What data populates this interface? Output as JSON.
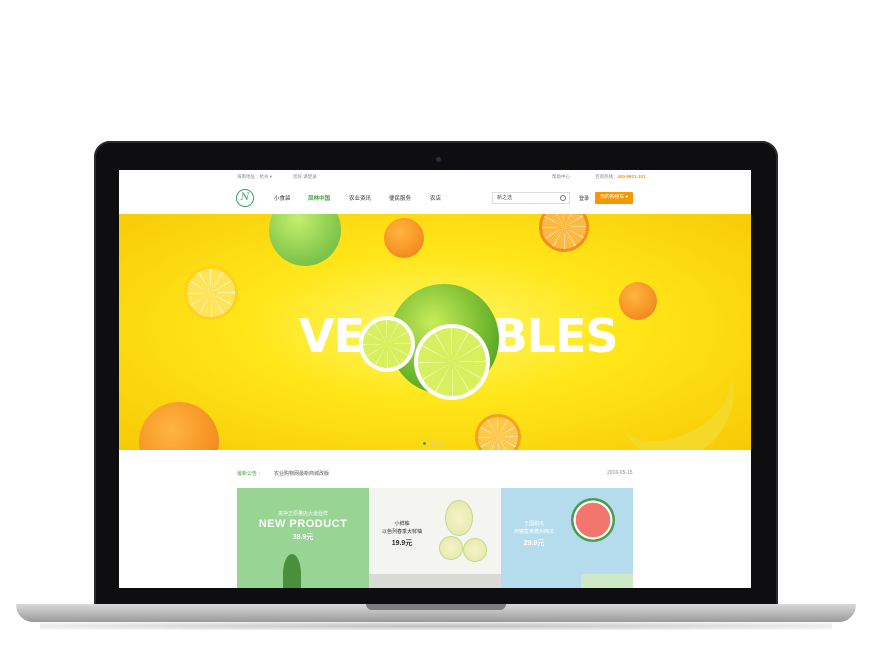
{
  "topbar": {
    "location": "海南地址：杭州 ▾",
    "login": "您好,请登录",
    "help": "帮助中心",
    "phone_label": "咨询热线：",
    "phone": "400-9921-101"
  },
  "nav": {
    "logo_letter": "N",
    "items": [
      "小食袋",
      "凤林中国",
      "农业资讯",
      "便民服务",
      "农店"
    ],
    "search_value": "新之选",
    "login_label": "登录",
    "cart_label": "我的购物车 ▾"
  },
  "banner": {
    "title": "VEGETABLES",
    "pagination_count": 3,
    "pagination_active": 0
  },
  "notice": {
    "label": "最新公告 ：",
    "text": "农业购物网最新商城改版",
    "date": "2016-05-15"
  },
  "products": [
    {
      "sub": "来净正原量店大道业样",
      "title": "NEW PRODUCT",
      "price": "38.9元"
    },
    {
      "sub1": "小鲜柚",
      "sub2": "以色列春季大鲜柚",
      "price": "19.9元"
    },
    {
      "sub1": "王国甜瓜",
      "sub2": "商镜售卖德州西瓜",
      "price": "29.9元"
    }
  ],
  "colors": {
    "accent": "#4a9e4a",
    "cart": "#f39800",
    "banner": "#ffe619"
  }
}
